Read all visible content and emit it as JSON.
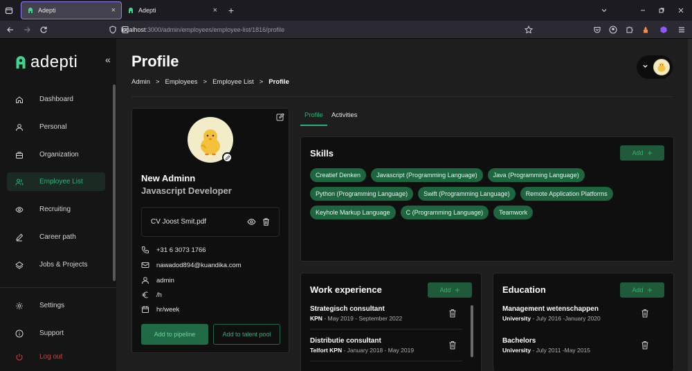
{
  "browser": {
    "tabs": [
      {
        "title": "Adepti",
        "close": "×"
      },
      {
        "title": "Adepti",
        "close": "×"
      }
    ],
    "new_tab": "+",
    "url_host": "localhost",
    "url_path": ":3000/admin/employees/employee-list/1816/profile"
  },
  "sidebar": {
    "logo": "adepti",
    "collapse": "«",
    "items": [
      {
        "label": "Dashboard",
        "icon": "home-icon"
      },
      {
        "label": "Personal",
        "icon": "person-icon"
      },
      {
        "label": "Organization",
        "icon": "briefcase-icon"
      },
      {
        "label": "Employee List",
        "icon": "users-icon",
        "active": true
      },
      {
        "label": "Recruiting",
        "icon": "eye-icon"
      },
      {
        "label": "Career path",
        "icon": "pen-icon"
      },
      {
        "label": "Jobs & Projects",
        "icon": "stack-icon"
      }
    ],
    "bottom": [
      {
        "label": "Settings",
        "icon": "gear-icon"
      },
      {
        "label": "Support",
        "icon": "info-icon"
      },
      {
        "label": "Log out",
        "icon": "power-icon"
      }
    ]
  },
  "header": {
    "title": "Profile",
    "breadcrumbs": [
      "Admin",
      "Employees",
      "Employee List",
      "Profile"
    ],
    "separator": ">",
    "chevron": "⌄"
  },
  "profile": {
    "name": "New Adminn",
    "role": "Javascript Developer",
    "cv_file": "CV Joost Smit.pdf",
    "phone": "+31 6 3073 1766",
    "email": "nawadod894@kuandika.com",
    "user_role": "admin",
    "rate": "/h",
    "hours": "hr/week",
    "add_pipeline": "Add to pipeline",
    "add_talent": "Add to talent pool"
  },
  "tabs": [
    "Profile",
    "Activities"
  ],
  "skills": {
    "title": "Skills",
    "add_label": "Add",
    "plus": "+",
    "items": [
      "Creatief Denken",
      "Javascript (Programming Language)",
      "Java (Programming Language)",
      "Python (Programming Language)",
      "Swift (Programming Language)",
      "Remote Application Platforms",
      "Keyhole Markup Language",
      "C (Programming Language)",
      "Teamwork"
    ]
  },
  "work": {
    "title": "Work experience",
    "add_label": "Add",
    "plus": "+",
    "items": [
      {
        "title": "Strategisch consultant",
        "org": "KPN",
        "dates": " - May 2019 - September 2022"
      },
      {
        "title": "Distributie consultant",
        "org": "Telfort KPN",
        "dates": " - January 2018 - May 2019"
      }
    ]
  },
  "education": {
    "title": "Education",
    "add_label": "Add",
    "plus": "+",
    "items": [
      {
        "title": "Management wetenschappen",
        "org": "University",
        "dates": " - July 2016 -January 2020"
      },
      {
        "title": "Bachelors",
        "org": "University",
        "dates": " - July 2011 -May 2015"
      }
    ]
  },
  "colors": {
    "accent": "#2fb27a",
    "chip": "#1d6640",
    "logout": "#e03a3a"
  }
}
